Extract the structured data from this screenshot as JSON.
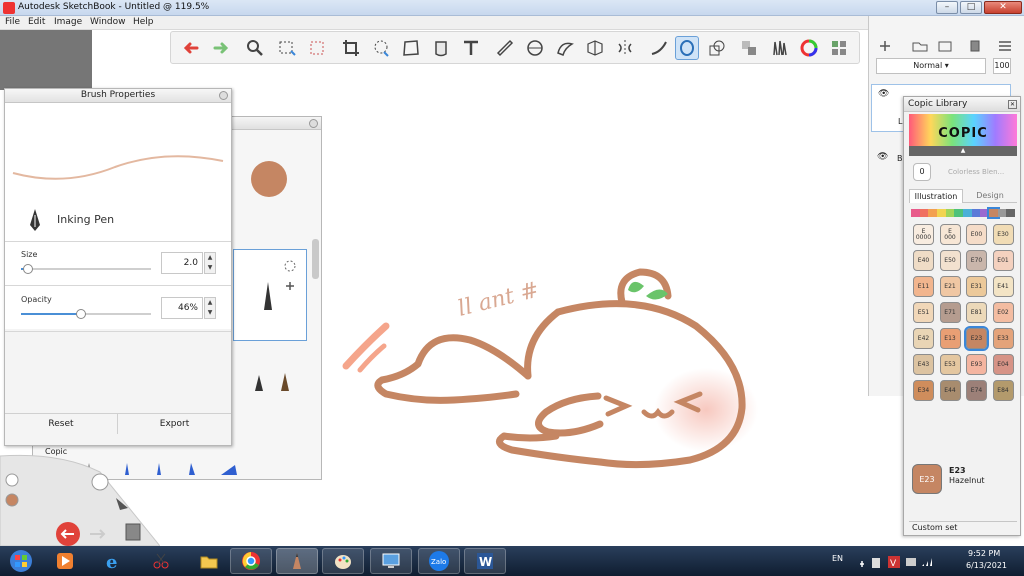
{
  "window": {
    "title": "Autodesk SketchBook - Untitled @ 119.5%",
    "minimize": "–",
    "maximize": "□",
    "close": "✕"
  },
  "menu": {
    "items": [
      "File",
      "Edit",
      "Image",
      "Window",
      "Help"
    ]
  },
  "toolbar": {
    "tools": [
      "undo-icon",
      "redo-icon",
      "zoom-icon",
      "rect-select-icon",
      "transform-select-icon",
      "crop-icon",
      "lasso-icon",
      "distort-icon",
      "bucket-icon",
      "text-icon",
      "ruler-icon",
      "ellipse-guide-icon",
      "french-curve-icon",
      "perspective-icon",
      "symmetry-icon",
      "stroke-icon",
      "predictive-stroke-icon",
      "shape-icon",
      "copic-library-icon",
      "brush-library-icon",
      "color-wheel-icon",
      "layer-grid-icon"
    ]
  },
  "brush_properties": {
    "title": "Brush Properties",
    "brush_name": "Inking Pen",
    "size_label": "Size",
    "size_value": "2.0",
    "size_fraction": 0.05,
    "opacity_label": "Opacity",
    "opacity_value": "46%",
    "opacity_fraction": 0.46,
    "reset_label": "Reset",
    "export_label": "Export",
    "stroke_color": "#e3b8a0",
    "dot_color": "#c58663"
  },
  "brush_library": {
    "set_label": "Copic"
  },
  "layers": {
    "blend_mode": "Normal",
    "opacity": "100",
    "layer_labels": [
      "La",
      "Ba"
    ]
  },
  "copic_library": {
    "title": "Copic Library",
    "logo_text": "COPIC",
    "colorless_label": "0",
    "colorless_name": "Colorless Blen...",
    "tabs": [
      "Illustration",
      "Design"
    ],
    "swatches": [
      {
        "code": "E\n0000",
        "color": "#f8ece0"
      },
      {
        "code": "E\n000",
        "color": "#f7e6d5"
      },
      {
        "code": "E00",
        "color": "#f5dcc8"
      },
      {
        "code": "E30",
        "color": "#f1dcb5"
      },
      {
        "code": "E40",
        "color": "#efdcc6"
      },
      {
        "code": "E50",
        "color": "#f2e1cf"
      },
      {
        "code": "E70",
        "color": "#c9b6ab"
      },
      {
        "code": "E01",
        "color": "#f4d1bf"
      },
      {
        "code": "E11",
        "color": "#f2b58e"
      },
      {
        "code": "E21",
        "color": "#f0c7a3"
      },
      {
        "code": "E31",
        "color": "#ecc99a"
      },
      {
        "code": "E41",
        "color": "#f3e4c5"
      },
      {
        "code": "E51",
        "color": "#f1d7b8"
      },
      {
        "code": "E71",
        "color": "#b59c8f"
      },
      {
        "code": "E81",
        "color": "#ecd9b9"
      },
      {
        "code": "E02",
        "color": "#f3bca1"
      },
      {
        "code": "E42",
        "color": "#e9d5b5"
      },
      {
        "code": "E13",
        "color": "#e99f74"
      },
      {
        "code": "E23",
        "color": "#c58663"
      },
      {
        "code": "E33",
        "color": "#e4a37a"
      },
      {
        "code": "E43",
        "color": "#dcc3a1"
      },
      {
        "code": "E53",
        "color": "#e4c7a0"
      },
      {
        "code": "E93",
        "color": "#f4b5a0"
      },
      {
        "code": "E04",
        "color": "#d69386"
      },
      {
        "code": "E34",
        "color": "#cf8d5c"
      },
      {
        "code": "E44",
        "color": "#a88c6e"
      },
      {
        "code": "E74",
        "color": "#9c8078"
      },
      {
        "code": "E84",
        "color": "#b39a6c"
      }
    ],
    "selected_code": "E23",
    "selected_name": "Hazelnut",
    "selected_color": "#c58663",
    "custom_set_label": "Custom set"
  },
  "canvas": {
    "signature_text": "ll ant #"
  },
  "taskbar": {
    "apps": [
      "start-orb-icon",
      "media-player-icon",
      "internet-explorer-icon",
      "snipping-tool-icon",
      "file-explorer-icon",
      "chrome-icon",
      "sketchbook-icon",
      "paint-icon",
      "remote-desktop-icon",
      "zalo-icon",
      "word-icon"
    ],
    "language": "EN",
    "time": "9:52 PM",
    "date": "6/13/2021"
  },
  "colors": {
    "accent": "#3a86d8",
    "line_art": "#c58663",
    "leaf": "#6ac46a"
  }
}
